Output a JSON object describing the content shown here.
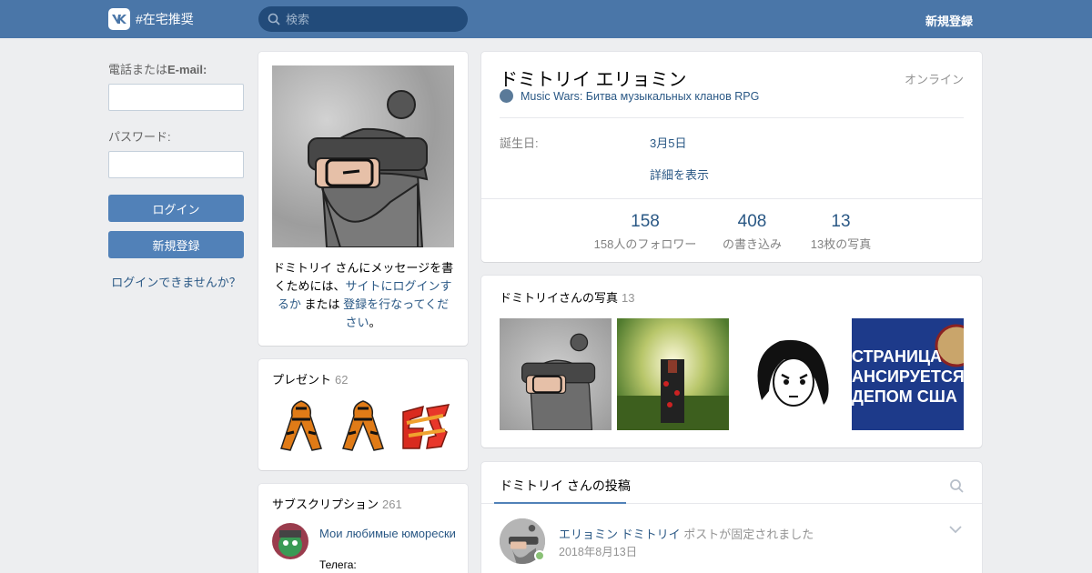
{
  "header": {
    "logo_text": "#在宅推奨",
    "search_placeholder": "検索",
    "signup": "新規登録"
  },
  "login": {
    "phone_label_prefix": "電話または",
    "phone_label_bold": "E-mail:",
    "password_label": "パスワード:",
    "login_button": "ログイン",
    "signup_button": "新規登録",
    "forgot_link": "ログインできませんか？"
  },
  "profile": {
    "name": "ドミトリイ エリョミン",
    "online": "オンライン",
    "status_text": "Music Wars: Битва музыкальных кланов RPG",
    "birthday_label": "誕生日:",
    "birthday_value": "3月5日",
    "show_more": "詳細を表示",
    "counters": [
      {
        "num": "158",
        "cap": "158人のフォロワー"
      },
      {
        "num": "408",
        "cap": "の書き込み"
      },
      {
        "num": "13",
        "cap": "13枚の写真"
      }
    ]
  },
  "message": {
    "text1": "ドミトリイ さんにメッセージを書くためには、",
    "link1": "サイトにログインするか",
    "text2": " または ",
    "link2": "登録を行なってください",
    "text3": "。"
  },
  "gifts": {
    "title": "プレゼント",
    "count": "62"
  },
  "subscriptions": {
    "title": "サブスクリプション",
    "count": "261",
    "item_title": "Мои любимые юморески",
    "item_desc": "Телега:"
  },
  "photos": {
    "title": "ドミトリイさんの写真",
    "count": "13",
    "banner_lines": [
      "СТРАНИЦА",
      "АНСИРУЕТСЯ",
      "ДЕПОМ США"
    ]
  },
  "posts": {
    "tab": "ドミトリイ さんの投稿",
    "author": "エリョミン ドミトリイ",
    "pinned": " ポストが固定されました",
    "date": "2018年8月13日"
  }
}
